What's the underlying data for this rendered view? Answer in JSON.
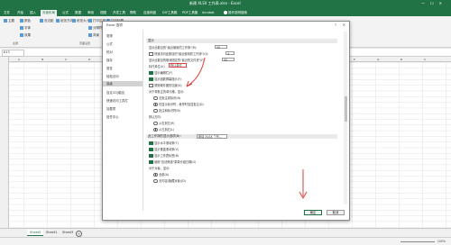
{
  "excel": {
    "window_title": "新建 XLSX 工作表.xlsx - Excel",
    "tabs": [
      "文件",
      "开始",
      "插入",
      "页面布局",
      "公式",
      "数据",
      "审阅",
      "视图",
      "开发工具",
      "帮助",
      "百度网盘",
      "DIY工具箱",
      "PDF工具集",
      "Acrobat"
    ],
    "active_tab_index": 3,
    "tell_me": "操作说明搜索",
    "ribbon": {
      "theme_label": "主题",
      "colors": "颜色",
      "fonts": "字体",
      "effects": "效果",
      "margins": "页边距",
      "orientation": "纸张方向",
      "size": "纸张大小",
      "print_area": "打印区域",
      "breaks": "分隔符",
      "background": "背景",
      "print_titles": "打印标题",
      "group_themes": "主题",
      "group_page_setup": "页面设置"
    },
    "name_box": "K13",
    "columns": [
      "A",
      "B",
      "C",
      "D",
      "E",
      "F",
      "G",
      "H",
      "I",
      "J",
      "K",
      "L",
      "M",
      "N",
      "O",
      "P",
      "Q",
      "R",
      "S"
    ],
    "sheets": [
      "Sheet2",
      "Sheet1",
      "Sheet3"
    ],
    "active_sheet_index": 0,
    "add_sheet": "+",
    "zoom": "100%"
  },
  "dialog": {
    "title": "Excel 选项",
    "help": "?",
    "close": "✕",
    "nav": [
      "常规",
      "公式",
      "校对",
      "保存",
      "语言",
      "轻松访问",
      "高级",
      "自定义功能区",
      "快速访问工具栏",
      "加载项",
      "信任中心"
    ],
    "active_nav_index": 6,
    "section_display": "显示",
    "recent_workbooks_label": "显示此数目的\"最近使用的工作簿\"(R):",
    "recent_workbooks_value": "50",
    "quick_access_label": "快速访问此数目的\"最近使用的工作簿\"(Q):",
    "quick_access_value": "4",
    "recent_folders_label": "显示此数目的取消固定的\"最近的文件夹\"(F):",
    "recent_folders_value": "50",
    "ruler_units_label": "标尺单位(U)",
    "ruler_units_value": "默认单位",
    "show_formula_bar": "显示编辑栏(F)",
    "show_function_tooltips": "显示函数屏幕提示(F)",
    "disable_hw_accel": "禁用硬件图形加速(G)",
    "comments_label": "对于带批注的单元格，显示:",
    "no_comments": "无批注或标识(N)",
    "indicators_only": "仅显示标识符，悬停时加显批注(D)",
    "comments_and_indicators": "批注和标识符(B)",
    "direction_label": "默认方向:",
    "right_to_left": "从右到左(R)",
    "left_to_right": "从左到右(L)",
    "section_workbook": "此工作簿的显示选项(B):",
    "workbook_value": "新建 XLSX 工作...",
    "show_h_scrollbar": "显示水平滚动条(T)",
    "show_v_scrollbar": "显示垂直滚动条(V)",
    "show_sheet_tabs": "显示工作表标签(B)",
    "group_dates": "使用\"自动筛选\"菜单分组日期(G)",
    "objects_label": "对于对象，显示:",
    "objects_all": "全部(A)",
    "objects_nothing": "无内容(隐藏对象)(D)",
    "ok": "确定",
    "cancel": "取消"
  },
  "colors": {
    "excel_green": "#217346",
    "annotation_red": "#e04040"
  }
}
